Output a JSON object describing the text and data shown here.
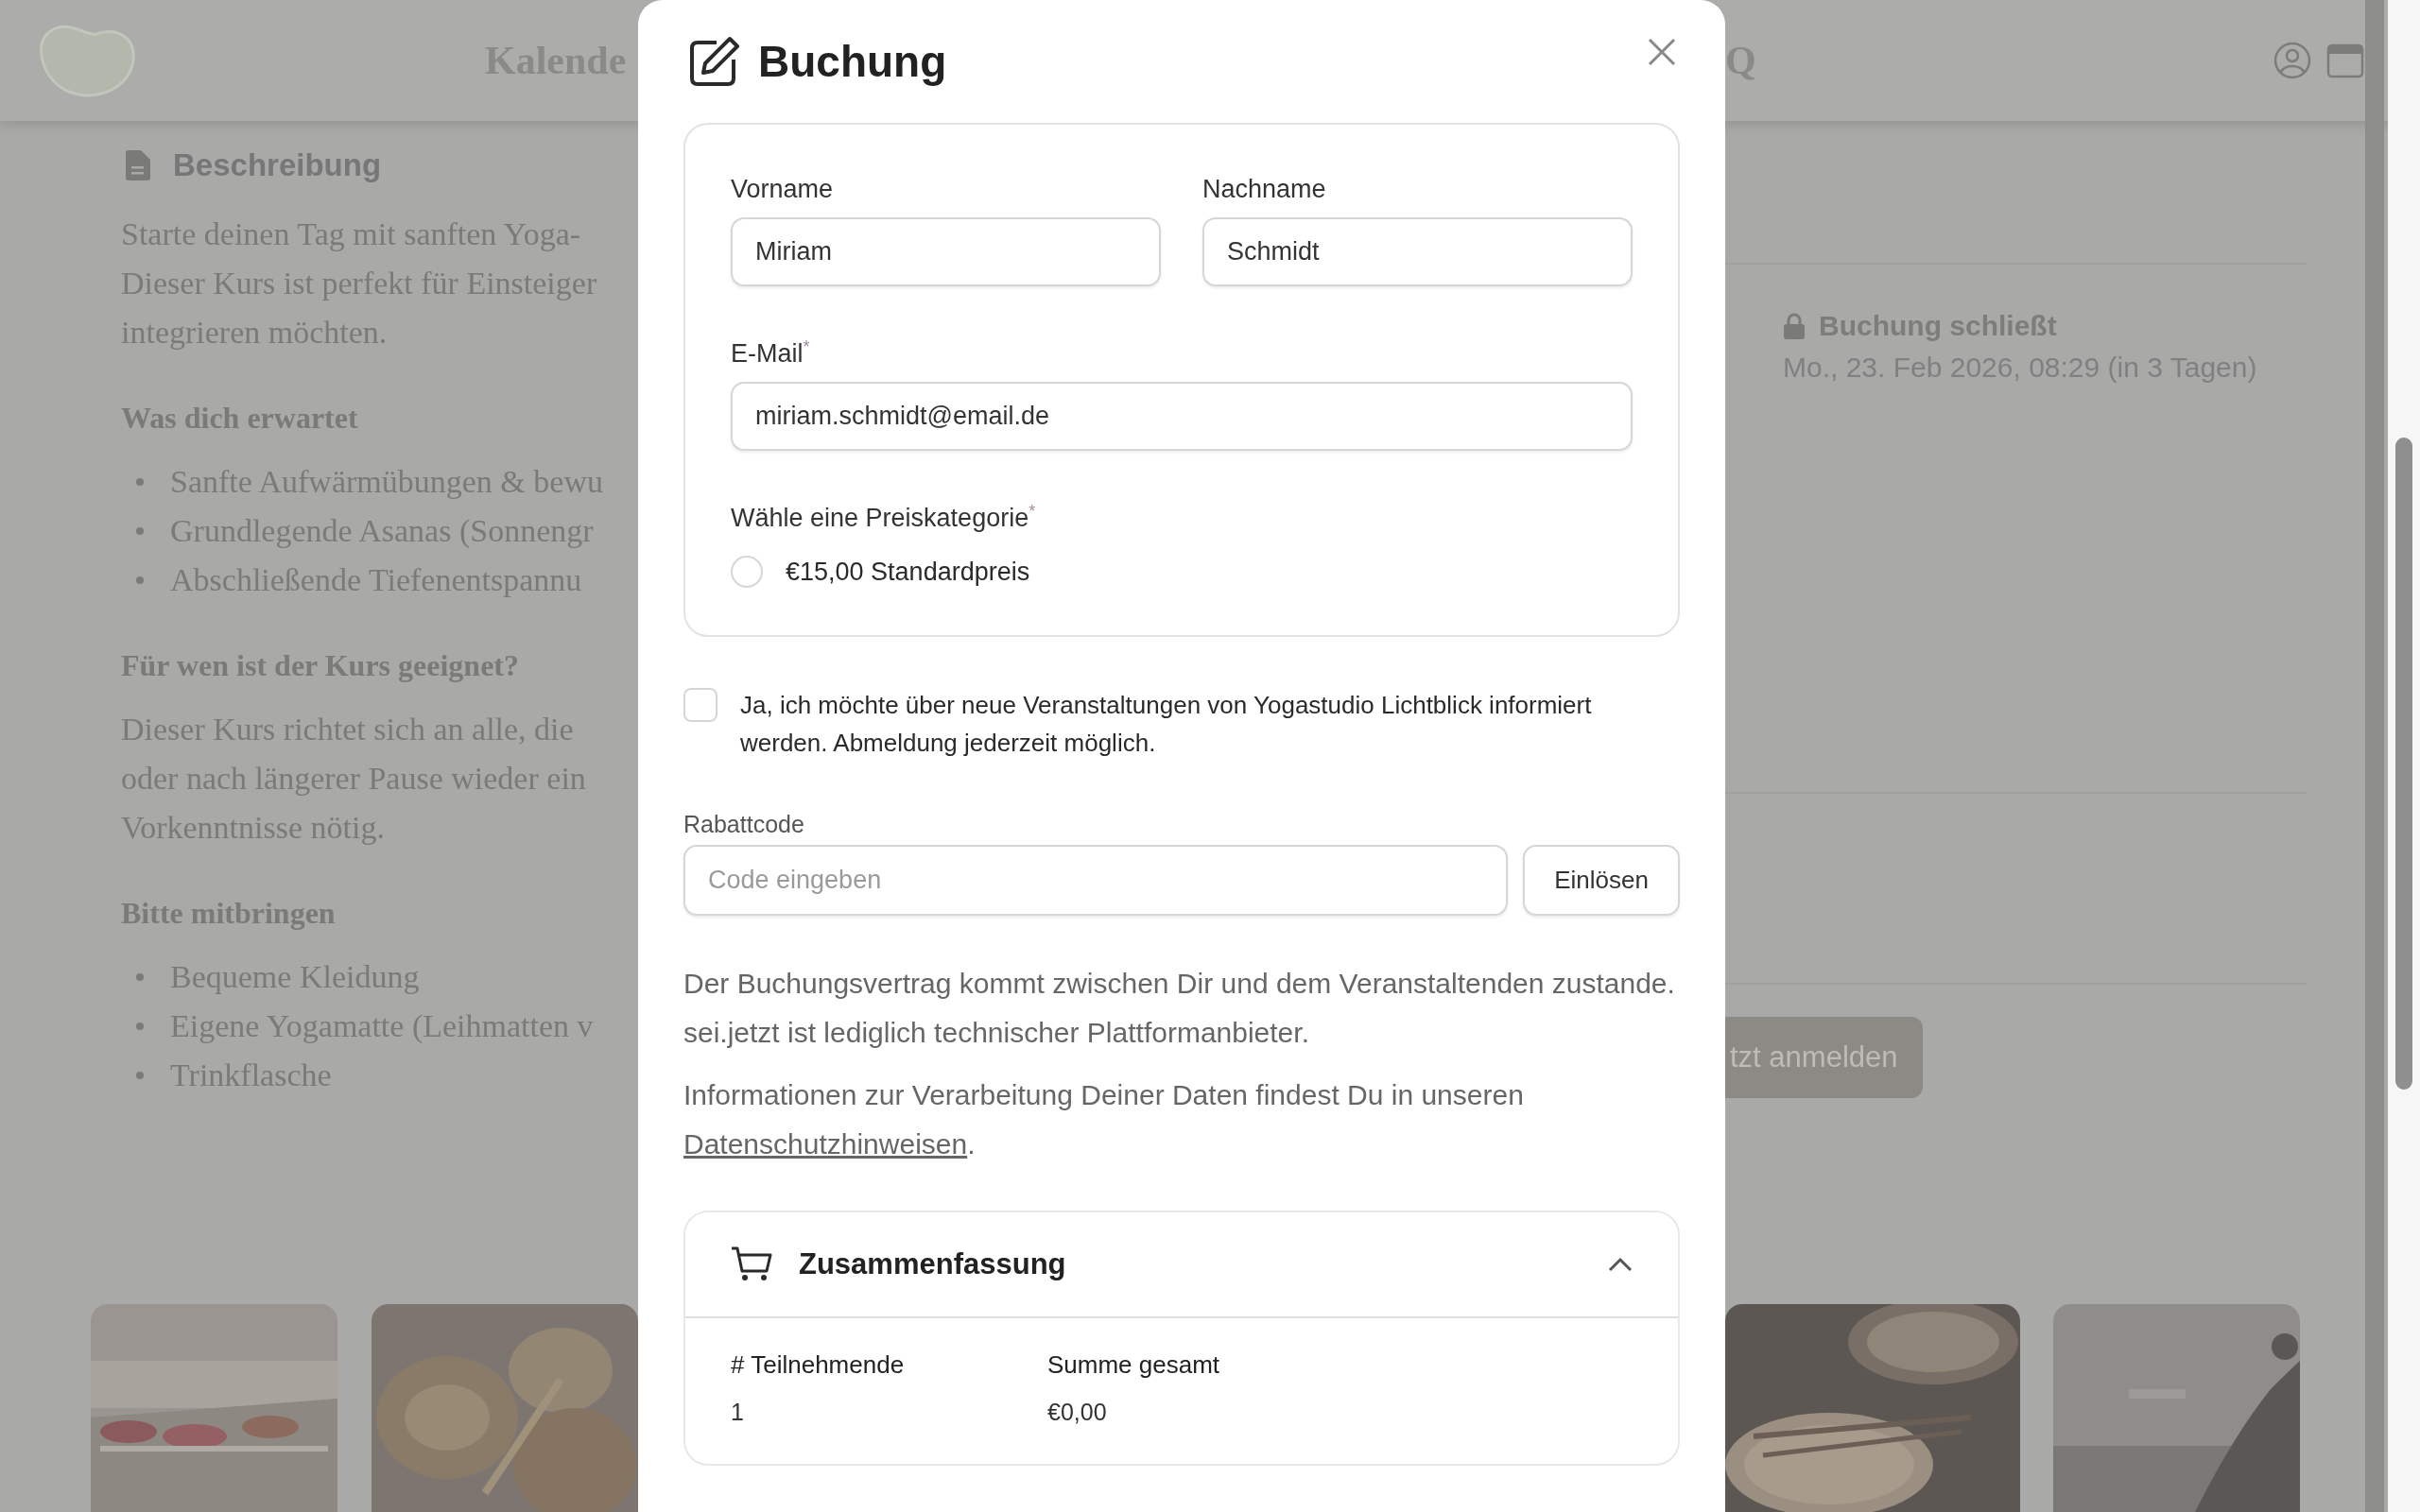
{
  "header": {
    "nav": [
      "Kalende",
      "Q"
    ]
  },
  "description": {
    "title": "Beschreibung",
    "blocks": [
      {
        "kind": "paragraph",
        "lines": [
          "Starte deinen Tag mit sanften Yoga-",
          "Dieser Kurs ist perfekt für Einsteiger",
          "integrieren möchten."
        ]
      },
      {
        "kind": "heading",
        "text": "Was dich erwartet"
      },
      {
        "kind": "list",
        "items": [
          "Sanfte Aufwärmübungen & bewu",
          "Grundlegende Asanas (Sonnengr",
          "Abschließende Tiefenentspannu"
        ]
      },
      {
        "kind": "heading",
        "text": "Für wen ist der Kurs geeignet?"
      },
      {
        "kind": "paragraph",
        "lines": [
          "Dieser Kurs richtet sich an alle, die",
          "oder nach längerer Pause wieder ein",
          "Vorkenntnisse nötig."
        ]
      },
      {
        "kind": "heading",
        "text": "Bitte mitbringen"
      },
      {
        "kind": "list",
        "items": [
          "Bequeme Kleidung",
          "Eigene Yogamatte (Leihmatten v",
          "Trinkflasche"
        ]
      }
    ]
  },
  "booking_info": {
    "label": "Buchung schließt",
    "date": "Mo., 23. Feb 2026, 08:29 (in 3 Tagen)",
    "button": "tzt anmelden"
  },
  "modal": {
    "title": "Buchung",
    "fields": [
      {
        "label": "Vorname",
        "value": "Miriam"
      },
      {
        "label": "Nachname",
        "value": "Schmidt"
      },
      {
        "label": "E-Mail$^{*}$",
        "value": "miriam.schmidt@email.de"
      }
    ],
    "price": {
      "label": "Wähle eine Preiskategorie$^{*}$",
      "options": [
        {
          "label": "€15,00 Standardpreis",
          "selected": false
        }
      ]
    },
    "newsletter": {
      "label": "Ja, ich möchte über neue Veranstaltungen von Yogastudio Lichtblick informiert werden. Abmeldung jederzeit möglich.",
      "checked": false
    },
    "discount": {
      "label": "Rabattcode",
      "placeholder": "Code eingeben",
      "button": "Einlösen"
    },
    "legal": "Der Buchungsvertrag kommt zwischen Dir und dem Veranstaltenden zustande. sei.jetzt ist lediglich technischer Plattformanbieter.",
    "privacy": {
      "text": "Informationen zur Verarbeitung Deiner Daten findest Du in unseren",
      "link": "Datenschutzhinweisen",
      "end": "."
    },
    "summary": {
      "title": "Zusammenfassung",
      "expanded": true,
      "columns": [
        "# Teilnehmende",
        "Summe gesamt"
      ],
      "rows": [
        [
          "1",
          "€0,00"
        ]
      ]
    }
  }
}
